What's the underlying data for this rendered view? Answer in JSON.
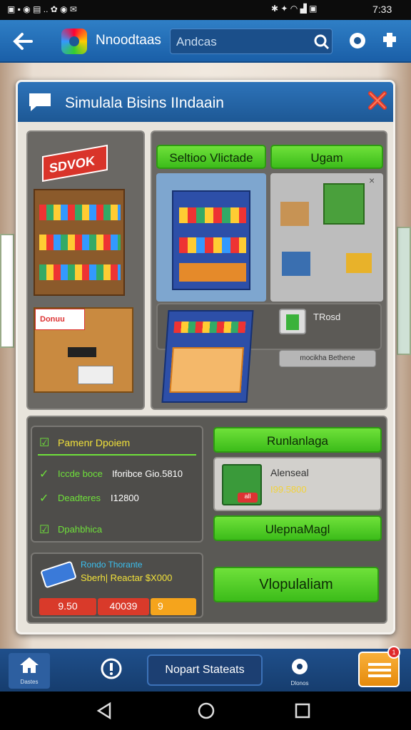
{
  "status_bar": {
    "time": "7:33"
  },
  "app_bar": {
    "app_name": "Nnoodtaas",
    "search_value": "Andcas",
    "icons": [
      "back-arrow-icon",
      "app-logo-icon",
      "search-icon",
      "settings-gear-icon",
      "puzzle-icon"
    ]
  },
  "dialog": {
    "title": "Simulala Bisins IIndaain",
    "store_sign": "SDVOK",
    "counter_sign": "Donuu",
    "buttons": {
      "select": "Seltioo Vlictade",
      "upgrade": "Ugam"
    },
    "item_label": "TRosd",
    "small_button": "mocikha Bethene"
  },
  "stats": {
    "header": "Pamenr Dpoiem",
    "rows": [
      {
        "label": "Iccde boce",
        "value": "Iforibce Gio.5810"
      },
      {
        "label": "Deadteres",
        "value": "I12800"
      },
      {
        "label": "Dpahbhica",
        "value": ""
      }
    ]
  },
  "right_actions": {
    "top_button": "Runlanlaga",
    "product_name": "Alenseal",
    "product_price": "I99.5800",
    "product_badge": "all",
    "bottom_button": "UlepnaMagl"
  },
  "bottom_card": {
    "title": "Rondo Thorante",
    "subtitle": "Sberh| Reactar $X000",
    "pills": [
      "9.50",
      "40039",
      "9"
    ],
    "big_button": "Vlopulaliam"
  },
  "nav": {
    "home_label": "Dastes",
    "info_label": "",
    "center_button": "Nopart Stateats",
    "settings_label": "Dlonos",
    "notification_count": "1"
  },
  "colors": {
    "accent_green": "#48c41f",
    "blue_bar": "#1d5895",
    "orange": "#f59a1c",
    "red": "#d93a2a"
  }
}
